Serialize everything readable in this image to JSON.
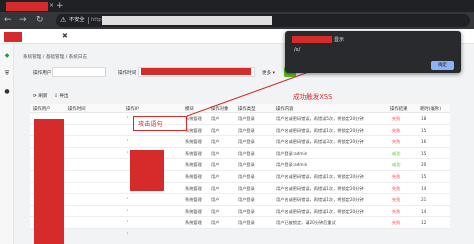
{
  "browser": {
    "tab_add": "+",
    "tab_close": "×",
    "insecure_label": "不安全",
    "url_scheme": "http:",
    "nav": {
      "back": "←",
      "forward": "→",
      "reload": "↻"
    }
  },
  "app": {
    "collapse_icon": "✖",
    "breadcrumb": "系统管理 / 基础管理 / 系统日志"
  },
  "filters": {
    "operator_label": "操作用户",
    "time_label": "操作时间",
    "more_label": "更多 ▾"
  },
  "toolbar": {
    "refresh_label": "刷新",
    "export_label": "导出"
  },
  "table": {
    "columns": [
      "操作用户",
      "操作时间",
      "操作IP",
      "模块",
      "操作对象",
      "操作类型",
      "操作内容",
      "操作结果",
      "耗时(毫秒)"
    ],
    "rows": [
      {
        "module": "系统管理",
        "object": "用户",
        "type": "用户登录",
        "content": "用户名或密码错误，再错误5次，将锁定20分钟",
        "result": "失败",
        "ms": "18"
      },
      {
        "module": "系统管理",
        "object": "用户",
        "type": "用户登录",
        "content": "用户名或密码错误，再错误1次，将锁定20分钟",
        "result": "失败",
        "ms": "15"
      },
      {
        "module": "系统管理",
        "object": "用户",
        "type": "用户登录",
        "content": "用户名或密码错误，再错误3次，将锁定20分钟",
        "result": "失败",
        "ms": "16"
      },
      {
        "module": "系统管理",
        "object": "用户",
        "type": "用户登录",
        "content": "用户登录:admin",
        "result": "成功",
        "ms": "15"
      },
      {
        "module": "系统管理",
        "object": "用户",
        "type": "用户登录",
        "content": "用户登录:admin",
        "result": "成功",
        "ms": "20"
      },
      {
        "module": "系统管理",
        "object": "用户",
        "type": "用户登录",
        "content": "用户名或密码错误，再错误1次，将锁定20分钟",
        "result": "失败",
        "ms": "15"
      },
      {
        "module": "系统管理",
        "object": "用户",
        "type": "用户登录",
        "content": "用户名或密码错误，再错误1次，将锁定20分钟",
        "result": "失败",
        "ms": "14"
      },
      {
        "module": "系统管理",
        "object": "用户",
        "type": "用户登录",
        "content": "用户名或密码错误，再错误1次，将锁定20分钟",
        "result": "失败",
        "ms": "21"
      },
      {
        "module": "系统管理",
        "object": "用户",
        "type": "用户登录",
        "content": "用户名或密码错误，再错误1次，将锁定20分钟",
        "result": "失败",
        "ms": "14"
      },
      {
        "module": "系统管理",
        "object": "用户",
        "type": "用户登录",
        "content": "用户已被锁定，请20分钟后重试",
        "result": "失败",
        "ms": "12"
      }
    ],
    "ip_dots": [
      "'",
      "'",
      "'",
      "'",
      "'",
      "'",
      "'"
    ]
  },
  "annotations": {
    "attack_label": "攻击语句",
    "xss_label": "成功触发XSS"
  },
  "alert": {
    "title_suffix": "显示",
    "message": "/x/",
    "ok_label": "确定"
  },
  "colors": {
    "redaction": "#d62b2b",
    "success": "#52c41a",
    "failure": "#ff4d4f"
  }
}
